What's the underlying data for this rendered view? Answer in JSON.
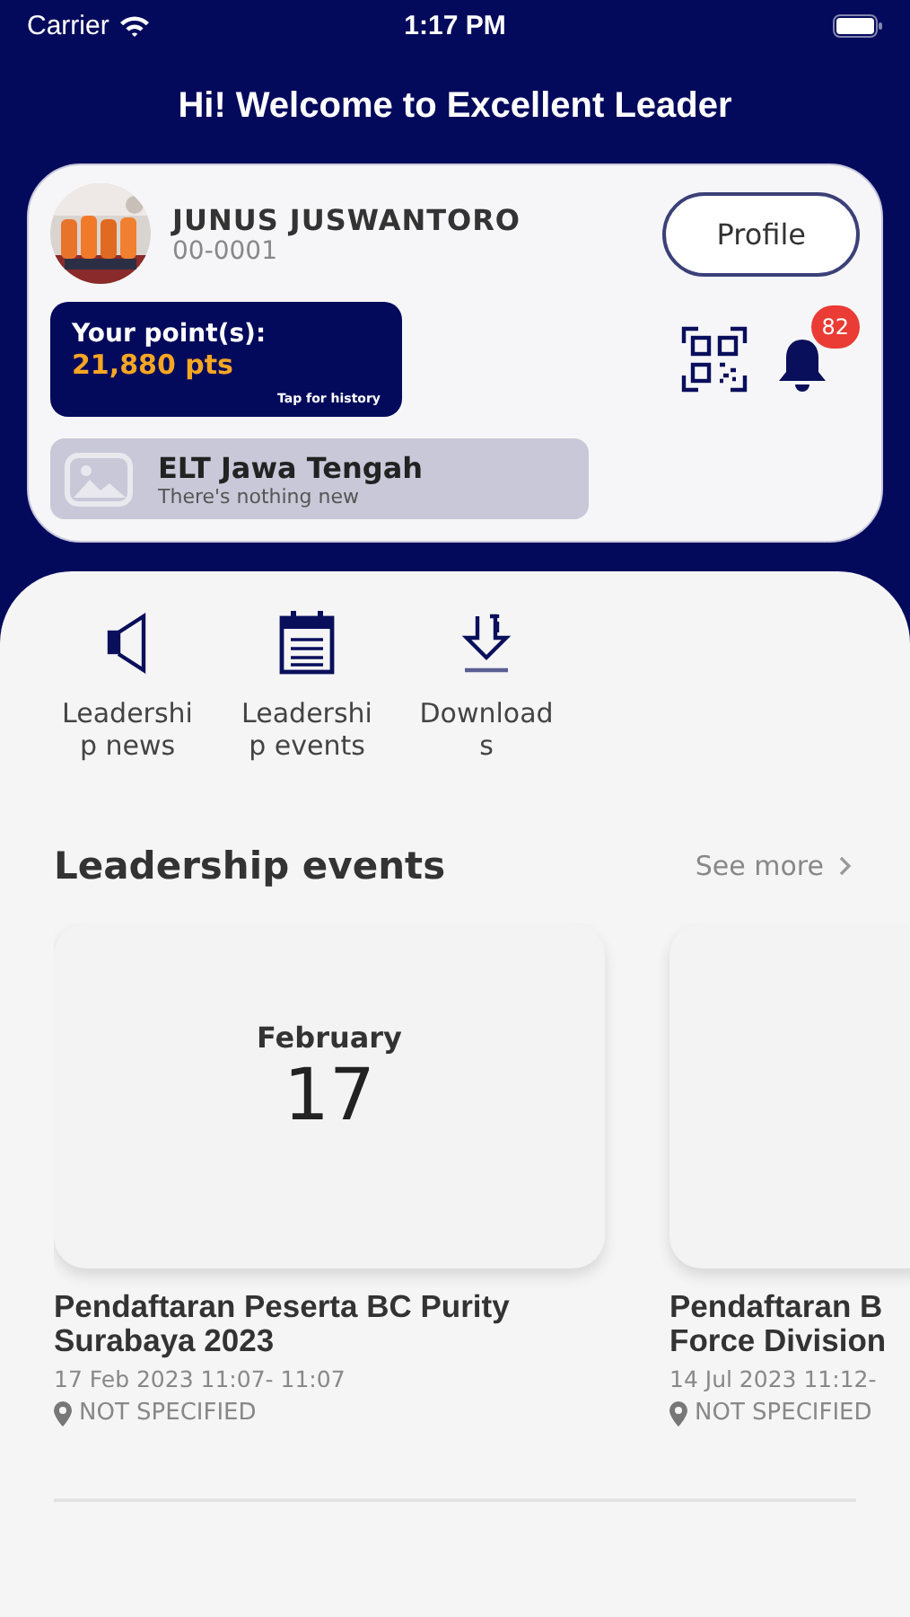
{
  "status_bar": {
    "carrier": "Carrier",
    "time": "1:17 PM"
  },
  "header": {
    "title": "Hi! Welcome to Excellent Leader"
  },
  "profile": {
    "name": "JUNUS JUSWANTORO",
    "member_id": "00-0001",
    "button": "Profile"
  },
  "points": {
    "label": "Your point(s):",
    "value": "21,880 pts",
    "hint": "Tap for history"
  },
  "notifications": {
    "badge": "82"
  },
  "group": {
    "title": "ELT Jawa Tengah",
    "subtitle": "There's nothing new"
  },
  "shortcuts": [
    {
      "kind": "news",
      "label": "Leadership news"
    },
    {
      "kind": "events",
      "label": "Leadership events"
    },
    {
      "kind": "downloads",
      "label": "Downloads"
    }
  ],
  "events": {
    "title": "Leadership events",
    "see_more": "See more",
    "items": [
      {
        "month": "February",
        "day": "17",
        "title": "Pendaftaran Peserta BC Purity Surabaya 2023",
        "time": "17 Feb 2023 11:07- 11:07",
        "location": "NOT SPECIFIED"
      },
      {
        "title": "Pendaftaran B\nForce Division",
        "time": "14 Jul 2023 11:12-",
        "location": "NOT SPECIFIED"
      }
    ]
  }
}
